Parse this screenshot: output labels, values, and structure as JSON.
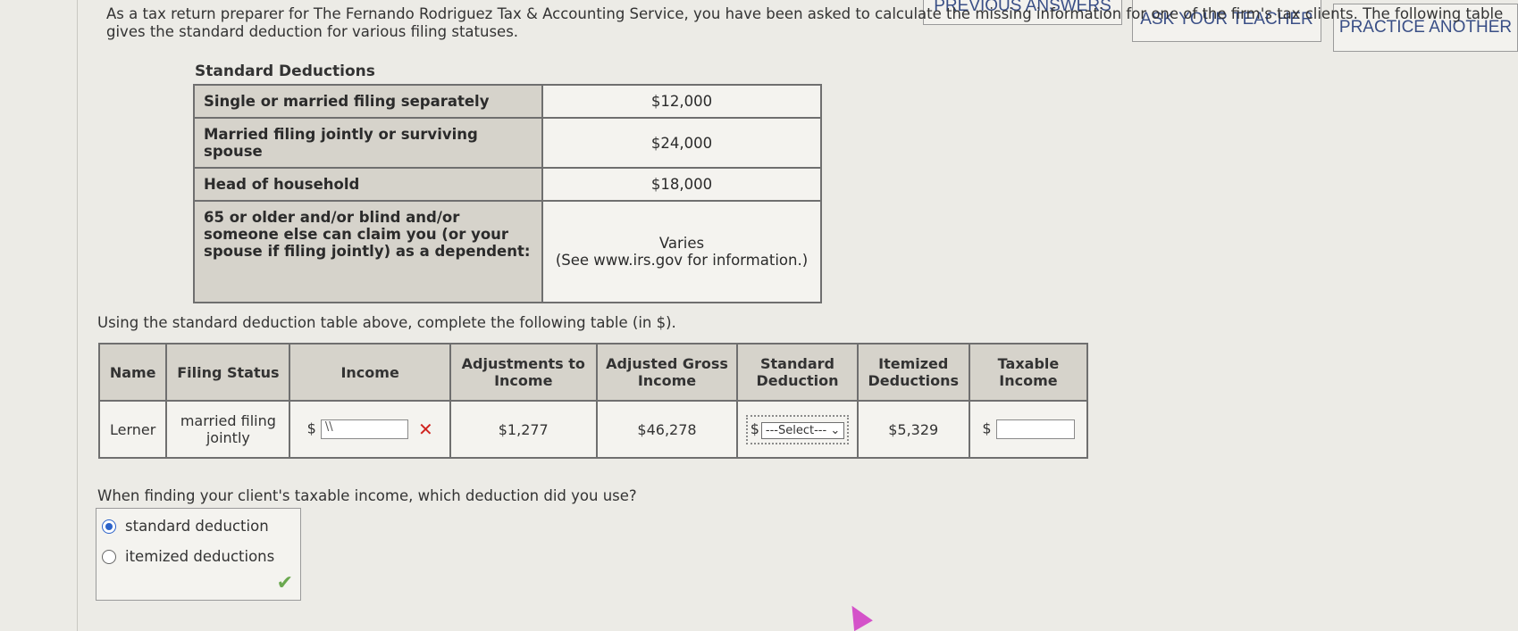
{
  "buttons": {
    "previous_answers": "PREVIOUS ANSWERS",
    "ask_teacher": "ASK YOUR TEACHER",
    "practice_another": "PRACTICE ANOTHER"
  },
  "intro": "As a tax return preparer for The Fernando Rodriguez Tax & Accounting Service, you have been asked to calculate the missing information for one of the firm's tax clients. The following table gives the standard deduction for various filing statuses.",
  "standard_deductions": {
    "title": "Standard Deductions",
    "rows": [
      {
        "label": "Single or married filing separately",
        "value": "$12,000"
      },
      {
        "label": "Married filing jointly or surviving spouse",
        "value": "$24,000"
      },
      {
        "label": "Head of household",
        "value": "$18,000"
      },
      {
        "label": "65 or older and/or blind and/or someone else can claim you (or your spouse if filing jointly) as a dependent:",
        "value": "Varies\n(See www.irs.gov for information.)"
      }
    ]
  },
  "instruction": "Using the standard deduction table above, complete the following table (in $).",
  "tax_table": {
    "headers": [
      "Name",
      "Filing Status",
      "Income",
      "Adjustments to Income",
      "Adjusted Gross Income",
      "Standard Deduction",
      "Itemized Deductions",
      "Taxable Income"
    ],
    "row": {
      "name": "Lerner",
      "filing_status": "married filing jointly",
      "income_prefix": "$",
      "income_value": "\\\\",
      "adjustments": "$1,277",
      "agi": "$46,278",
      "standard_prefix": "$",
      "standard_select": "---Select---",
      "itemized": "$5,329",
      "taxable_prefix": "$",
      "taxable_value": ""
    }
  },
  "question": "When finding your client's taxable income, which deduction did you use?",
  "options": [
    {
      "label": "standard deduction",
      "selected": true
    },
    {
      "label": "itemized deductions",
      "selected": false
    }
  ],
  "colors": {
    "accent": "#2c63c9",
    "error": "#d0231f",
    "correct": "#6aa84f"
  }
}
